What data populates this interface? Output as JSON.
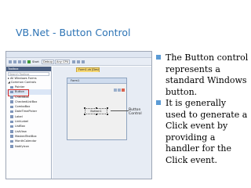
{
  "slide": {
    "title": "VB.Net - Button Control",
    "bullets": [
      "The Button control represents a standard Windows button.",
      "It is generally used to generate a Click event by providing a handler for the Click event."
    ]
  },
  "screenshot": {
    "toolbar": {
      "start_label": "Start",
      "config": "Debug",
      "platform": "Any CPU"
    },
    "toolbox": {
      "header": "Toolbox",
      "search_placeholder": "Search Toolbox",
      "groups": [
        "All Windows Forms",
        "Common Controls"
      ],
      "items": [
        "Pointer",
        "Button",
        "CheckBox",
        "CheckedListBox",
        "ComboBox",
        "DateTimePicker",
        "Label",
        "LinkLabel",
        "ListBox",
        "ListView",
        "MaskedTextBox",
        "MonthCalendar",
        "NotifyIcon"
      ],
      "selected_item": "Button"
    },
    "designer": {
      "tab_label": "Form1.vb [Design]*",
      "form_title": "Form1",
      "button_text": "Button1",
      "callout": "Button Control"
    }
  },
  "colors": {
    "title": "#2e74b5",
    "bullet": "#5b9bd5",
    "highlight": "#d12b2b"
  }
}
